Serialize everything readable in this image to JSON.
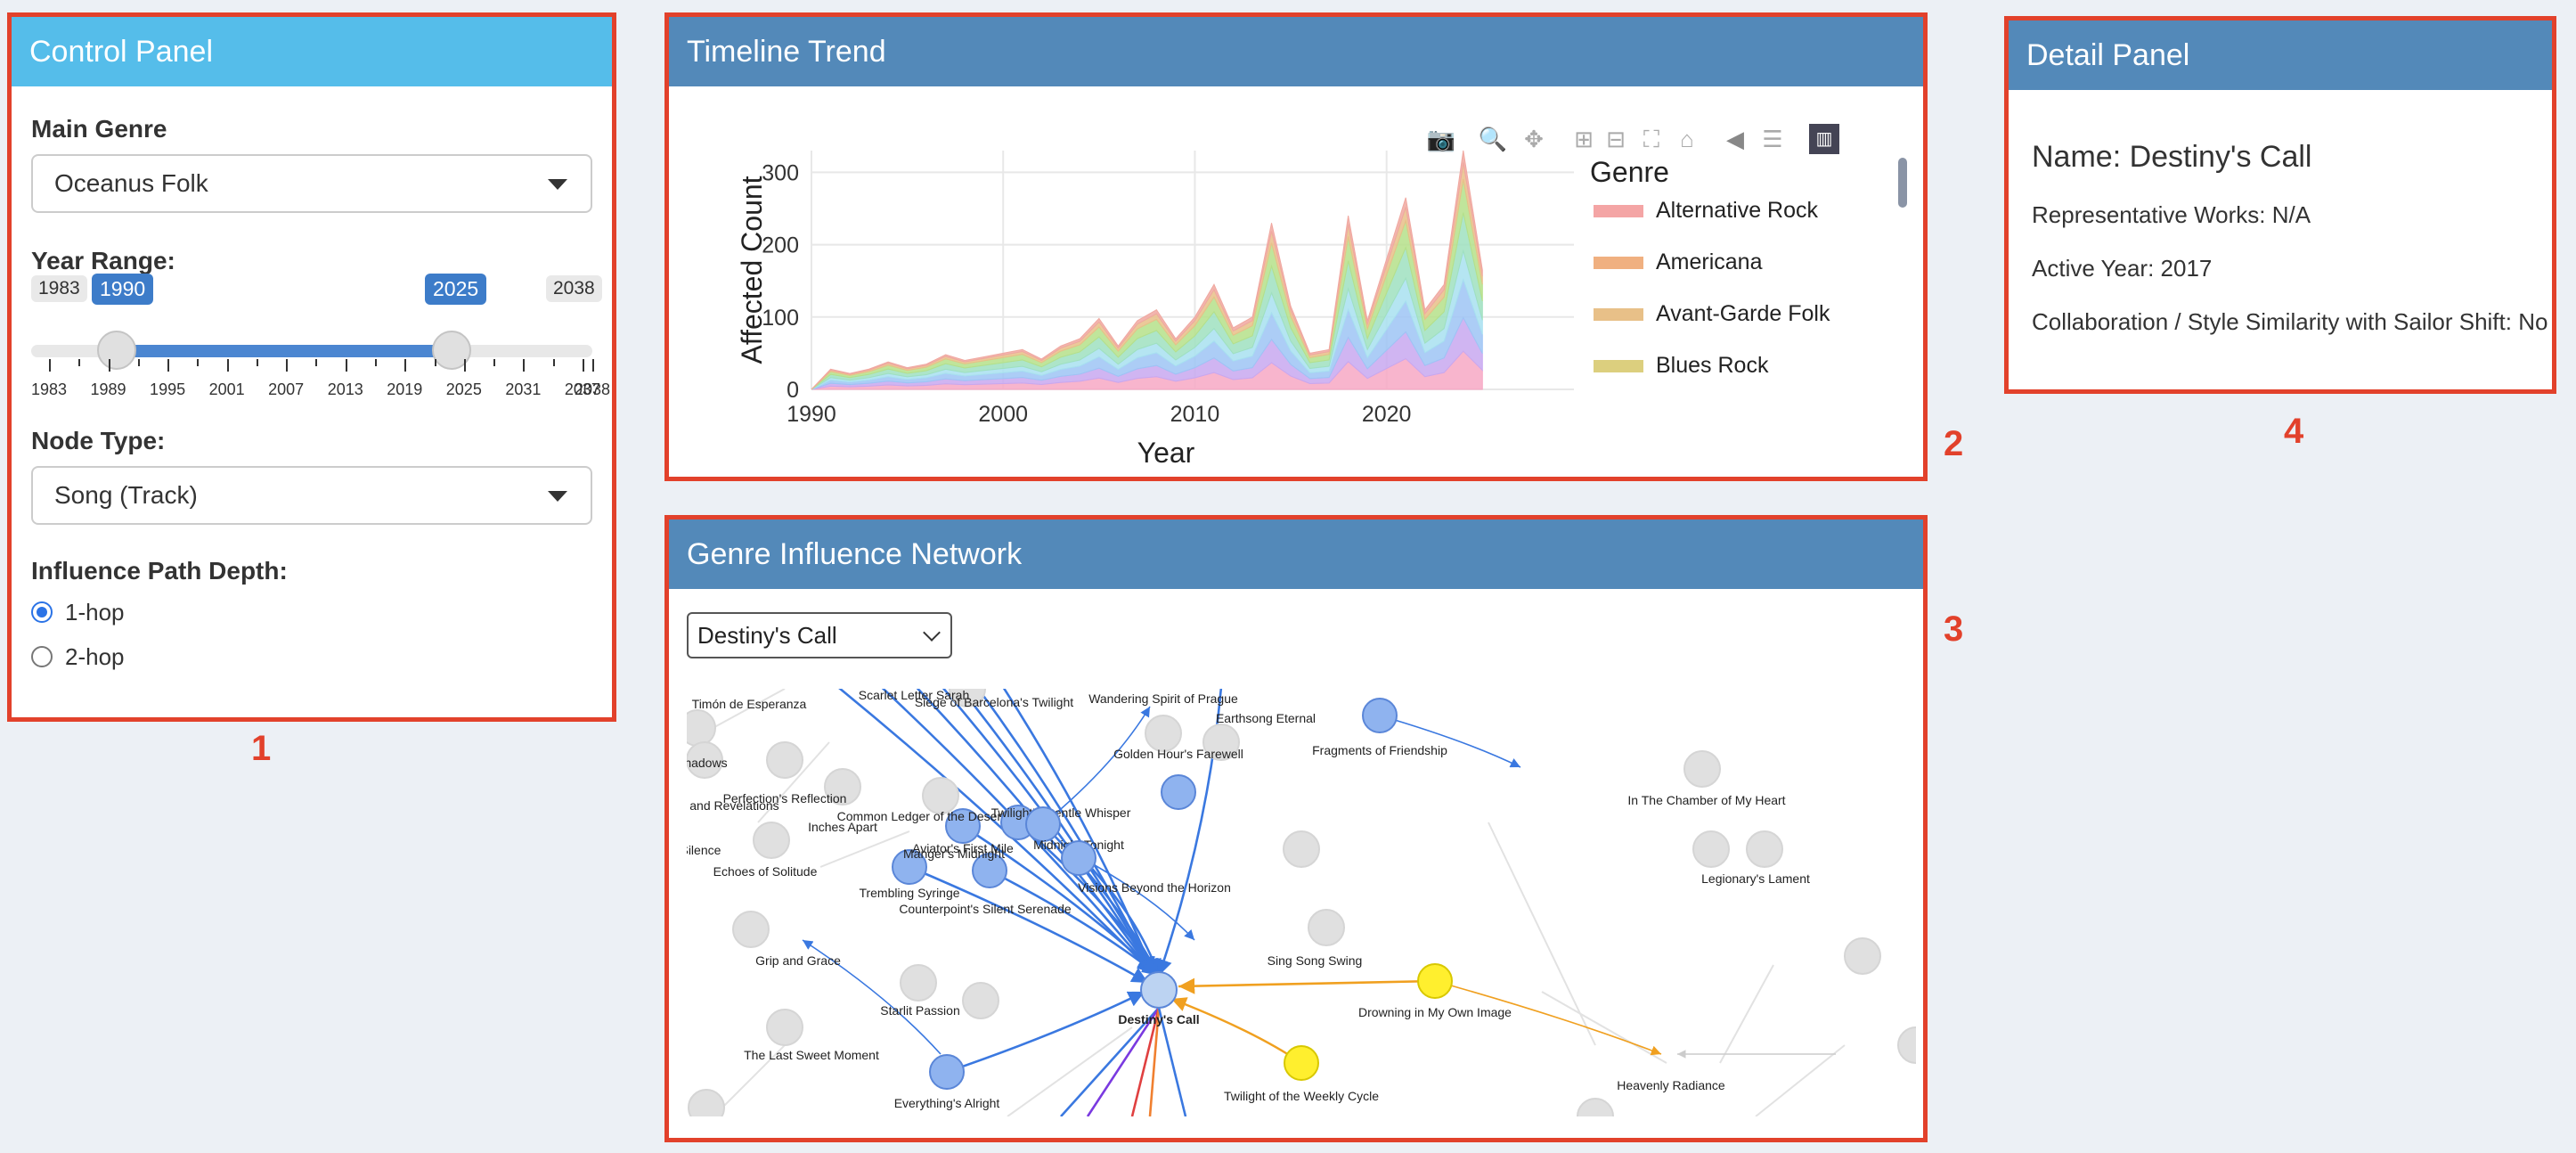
{
  "control_panel": {
    "title": "Control Panel",
    "marker": "1",
    "main_genre_label": "Main Genre",
    "main_genre_value": "Oceanus Folk",
    "year_range_label": "Year Range:",
    "year_min": "1983",
    "year_max": "2038",
    "year_from": "1990",
    "year_to": "2025",
    "year_ticks": [
      "1983",
      "1989",
      "1995",
      "2001",
      "2007",
      "2013",
      "2019",
      "2025",
      "2031",
      "2037",
      "2038"
    ],
    "node_type_label": "Node Type:",
    "node_type_value": "Song (Track)",
    "depth_label": "Influence Path Depth:",
    "depth_options": [
      "1-hop",
      "2-hop"
    ],
    "depth_selected": "1-hop"
  },
  "timeline": {
    "title": "Timeline Trend",
    "marker": "2",
    "modebar_icons": [
      "camera-icon",
      "zoom-icon",
      "pan-icon",
      "zoom-in-icon",
      "zoom-out-icon",
      "autoscale-icon",
      "reset-axes-icon",
      "hover-closest-icon",
      "hover-compare-icon",
      "plotly-logo-icon"
    ]
  },
  "network": {
    "title": "Genre Influence Network",
    "marker": "3",
    "selected_node": "Destiny's Call",
    "colors": {
      "selected": "#bcd3f2",
      "blue": "#8fb3ef",
      "yellow": "#ffef2e",
      "gray": "#e0e0e0",
      "edge_blue": "#3a78e0",
      "edge_orange": "#f0a020"
    },
    "node_labels": {
      "timon": "Timón de Esperanza",
      "scarlet": "Scarlet Letter Sarah",
      "siege": "Siege of Barcelona's Twilight",
      "wandering": "Wandering Spirit of Prague",
      "earthsong": "Earthsong Eternal",
      "shadows": "'s Shadows",
      "fragments": "Fragments of Friendship",
      "golden": "Golden Hour's Farewell",
      "revelations": "s and Revelations",
      "perfection": "Perfection's Reflection",
      "chamber": "In The Chamber of My Heart",
      "inches": "Inches Apart",
      "common": "Common Ledger of the Desert Riders",
      "twilight_gentle": "Twilight's Gentle Whisper",
      "silence": "s Silence",
      "echoes": "Echoes of Solitude",
      "aviator": "Aviator's First Mile",
      "manger": "Manger's Midnight",
      "midnight_tonight": "Midnight Tonight",
      "trembling": "Trembling Syringe",
      "visions": "Visions Beyond the Horizon",
      "legionary": "Legionary's Lament",
      "counterpoint": "Counterpoint's Silent Serenade",
      "sing": "Sing Song Swing",
      "grip": "Grip and Grace",
      "starlit": "Starlit Passion",
      "destiny": "Destiny's Call",
      "last_sweet": "The Last Sweet Moment",
      "drowning": "Drowning in My Own Image",
      "everything": "Everything's Alright",
      "twilight_weekly": "Twilight of the Weekly Cycle",
      "heavenly": "Heavenly Radiance"
    }
  },
  "detail": {
    "title": "Detail Panel",
    "marker": "4",
    "name_line": "Name: Destiny's Call",
    "works_line": "Representative Works: N/A",
    "year_line": "Active Year: 2017",
    "collab_line": "Collaboration / Style Similarity with Sailor Shift: No"
  },
  "chart_data": {
    "type": "area",
    "title": "",
    "xlabel": "Year",
    "ylabel": "Affected Count",
    "xlim": [
      1990,
      2025
    ],
    "ylim": [
      0,
      330
    ],
    "x_ticks": [
      1990,
      2000,
      2010,
      2020
    ],
    "y_ticks": [
      0,
      100,
      200,
      300
    ],
    "grid": true,
    "legend_title": "Genre",
    "legend_position": "right",
    "x": [
      1990,
      1991,
      1992,
      1993,
      1994,
      1995,
      1996,
      1997,
      1998,
      1999,
      2000,
      2001,
      2002,
      2003,
      2004,
      2005,
      2006,
      2007,
      2008,
      2009,
      2010,
      2011,
      2012,
      2013,
      2014,
      2015,
      2016,
      2017,
      2018,
      2019,
      2020,
      2021,
      2022,
      2023,
      2024,
      2025
    ],
    "total": [
      0,
      28,
      22,
      28,
      38,
      30,
      35,
      48,
      40,
      45,
      50,
      55,
      42,
      60,
      70,
      98,
      60,
      95,
      110,
      70,
      100,
      145,
      85,
      100,
      230,
      115,
      50,
      55,
      240,
      95,
      180,
      265,
      110,
      145,
      330,
      165
    ],
    "series": [
      {
        "name": "Alternative Rock",
        "color": "#f4a5a5"
      },
      {
        "name": "Americana",
        "color": "#f0b080"
      },
      {
        "name": "Avant-Garde Folk",
        "color": "#e8c088"
      },
      {
        "name": "Blues Rock",
        "color": "#dccf7e"
      }
    ]
  }
}
